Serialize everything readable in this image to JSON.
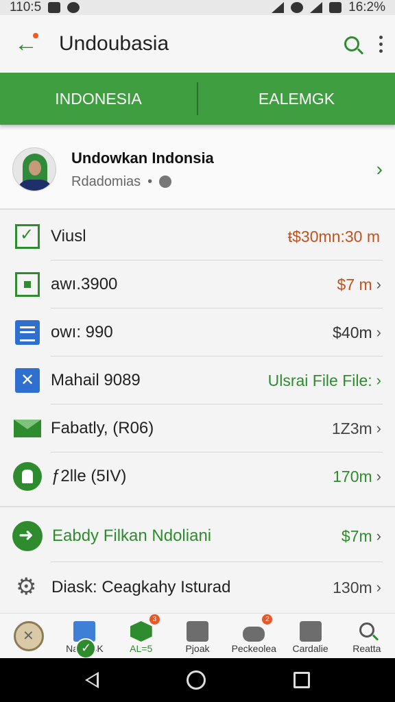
{
  "status_bar": {
    "time": "110:5",
    "battery": "16:2%"
  },
  "app_bar": {
    "title": "Undoubasia",
    "back_icon": "back-arrow-icon",
    "search_icon": "search-icon",
    "menu_icon": "more-vert-icon"
  },
  "tabs": [
    {
      "label": "INDONESIA"
    },
    {
      "label": "EALEMGK"
    }
  ],
  "profile": {
    "name": "Undowkan Indonsia",
    "subtitle": "Rdadomias",
    "separator": "•"
  },
  "rows": [
    {
      "icon": "checkbox-icon",
      "label": "Viusl",
      "value": "ŧ$30mn:30 m",
      "value_color": "#c0521f",
      "chevron": ""
    },
    {
      "icon": "square-icon",
      "label": "awı.3900",
      "value": "$7 m",
      "value_color": "#c0521f",
      "chevron": "›"
    },
    {
      "icon": "document-icon",
      "label": "owı: 990",
      "value": "$40m",
      "value_color": "#333333",
      "chevron": "›"
    },
    {
      "icon": "close-box-icon",
      "label": "Mahail 9089",
      "value": "Ulsrai File File:",
      "value_color": "#2e8b2e",
      "chevron": "›"
    },
    {
      "icon": "mail-icon",
      "label": "Fabatly, (R06)",
      "value": "1Z3m",
      "value_color": "#444444",
      "chevron": "›"
    },
    {
      "icon": "chef-hat-icon",
      "label": "ƒ2lle (5IV)",
      "value": "170m",
      "value_color": "#2e8b2e",
      "chevron": "›"
    },
    {
      "icon": "arrow-circle-icon",
      "label": "Eabdy Filkan Ndoliani",
      "value": "$7m",
      "value_color": "#2e8b2e",
      "chevron": "›",
      "label_color": "#2e8b2e"
    },
    {
      "icon": "gear-icon",
      "label": "Diask: Ceagkahy Isturad",
      "value": "130m",
      "value_color": "#444444",
      "chevron": "›"
    }
  ],
  "bottom_nav": [
    {
      "icon": "compass-icon",
      "label": ""
    },
    {
      "icon": "file-icon",
      "label": "Naab 4K"
    },
    {
      "icon": "hexagon-icon",
      "label": "AL=5",
      "badge": "3",
      "green": true
    },
    {
      "icon": "box-icon",
      "label": "Pjoak",
      "badge": ""
    },
    {
      "icon": "stack-icon",
      "label": "Peckeolea",
      "badge": "2"
    },
    {
      "icon": "chart-icon",
      "label": "Cardalie"
    },
    {
      "icon": "search-icon",
      "label": "Reatta"
    }
  ],
  "colors": {
    "accent": "#3f9e3f",
    "accent_dark": "#2e8b2e",
    "warning": "#c0521f"
  }
}
